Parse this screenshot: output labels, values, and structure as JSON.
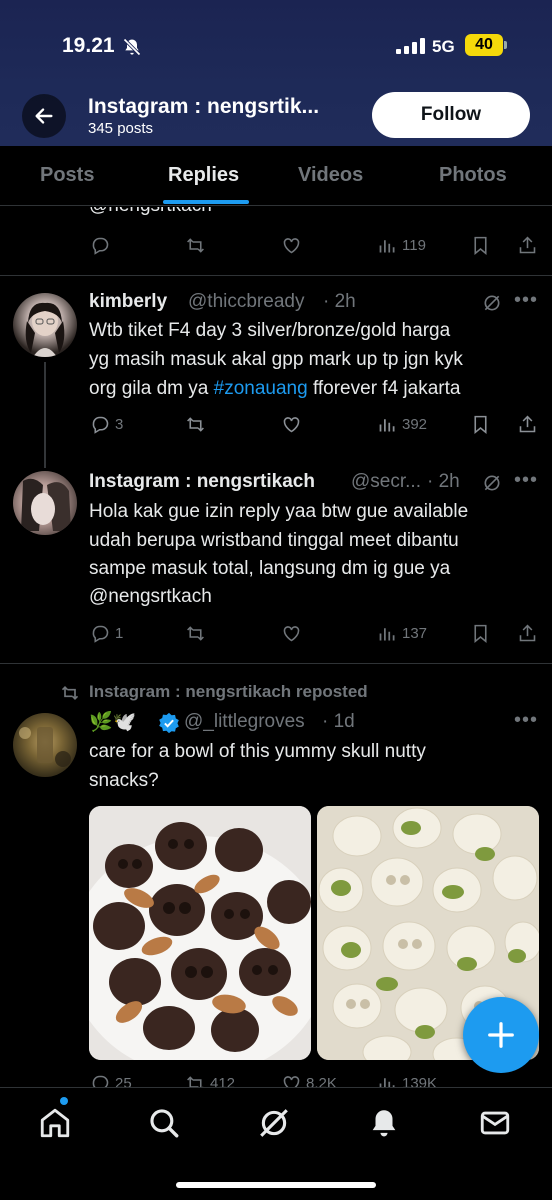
{
  "status_bar": {
    "time": "19.21",
    "network": "5G",
    "battery": "40"
  },
  "header": {
    "name": "Instagram : nengsrtik...",
    "posts": "345 posts",
    "follow": "Follow"
  },
  "tabs": [
    "Posts",
    "Replies",
    "Videos",
    "Photos"
  ],
  "top_fragment": {
    "text": "@nengsrtkach",
    "views": "119"
  },
  "post1": {
    "name": "kimberly",
    "handle": "@thiccbready",
    "time": "· 2h",
    "line1": "Wtb tiket F4 day 3 silver/bronze/gold harga",
    "line2": "yg masih masuk akal gpp mark up tp jgn kyk",
    "line3a": "org gila dm ya ",
    "hashtag": "#zonauang",
    "line3b": " fforever f4 jakarta",
    "replies": "3",
    "views": "392"
  },
  "post2": {
    "name": "Instagram : nengsrtikach",
    "handle": "@secr...",
    "time": "· 2h",
    "line1": "Hola kak gue izin reply yaa btw gue available",
    "line2": "udah berupa wristband tinggal meet dibantu",
    "line3": "sampe masuk total, langsung dm ig gue ya",
    "line4": "@nengsrtkach",
    "replies": "1",
    "views": "137"
  },
  "post3": {
    "repost_label": "Instagram : nengsrtikach reposted",
    "emoji": "🌿🕊️",
    "handle": "@_littlegroves",
    "time": "· 1d",
    "line1": "care for a bowl of this yummy skull nutty",
    "line2": "snacks?",
    "replies": "25",
    "reposts": "412",
    "likes": "8.2K",
    "views": "139K"
  },
  "colors": {
    "accent": "#1d9bf0",
    "background": "#000000",
    "muted": "#71767b",
    "text": "#e7e9ea"
  },
  "icons": [
    "back-arrow-icon",
    "bell-off-icon",
    "reply-icon",
    "repost-icon",
    "like-icon",
    "views-icon",
    "bookmark-icon",
    "share-icon",
    "grok-icon",
    "verified-icon",
    "plus-icon",
    "home-icon",
    "search-icon",
    "mail-icon",
    "notifications-icon"
  ]
}
